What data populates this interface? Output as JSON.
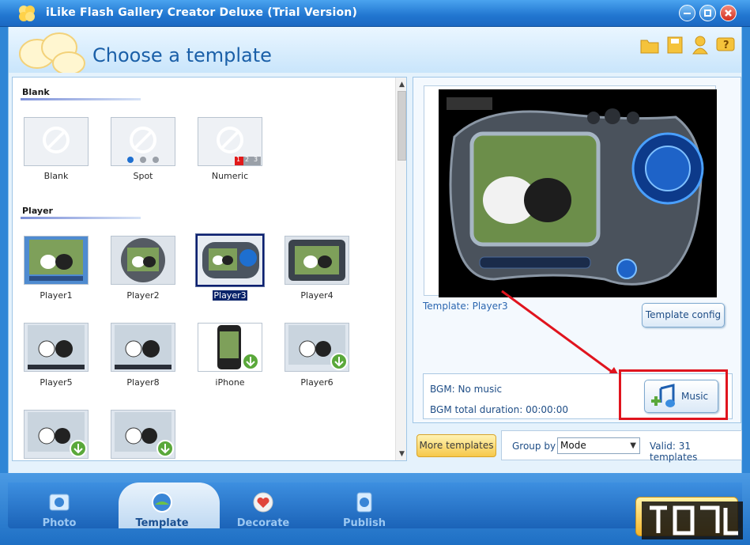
{
  "window": {
    "title": "iLike Flash Gallery Creator Deluxe (Trial Version)"
  },
  "header": {
    "title": "Choose a template",
    "icons": [
      "folder-icon",
      "save-icon",
      "user-icon",
      "help-icon"
    ]
  },
  "left_panel": {
    "sections": [
      {
        "title": "Blank",
        "items": [
          "Blank",
          "Spot",
          "Numeric"
        ]
      },
      {
        "title": "Player",
        "items": [
          "Player1",
          "Player2",
          "Player3",
          "Player4",
          "Player5",
          "Player8",
          "iPhone",
          "Player6"
        ]
      }
    ],
    "numeric_digits": [
      "1",
      "2",
      "3"
    ],
    "selected": "Player3"
  },
  "right_panel": {
    "template_label": "Template:  Player3",
    "template_config": "Template config",
    "bgm": "BGM: No music",
    "bgm_duration": "BGM total duration: 00:00:00",
    "music_button": "Music"
  },
  "toolbar": {
    "more_templates": "More templates",
    "group_by": "Group by",
    "group_value": "Mode",
    "valid": "Valid: 31 templates"
  },
  "bottom_nav": {
    "tabs": [
      "Photo",
      "Template",
      "Decorate",
      "Publish"
    ],
    "active": "Template"
  },
  "colors": {
    "accent": "#1a5fa8",
    "highlight_red": "#e0141e",
    "selection": "#0a246a"
  }
}
